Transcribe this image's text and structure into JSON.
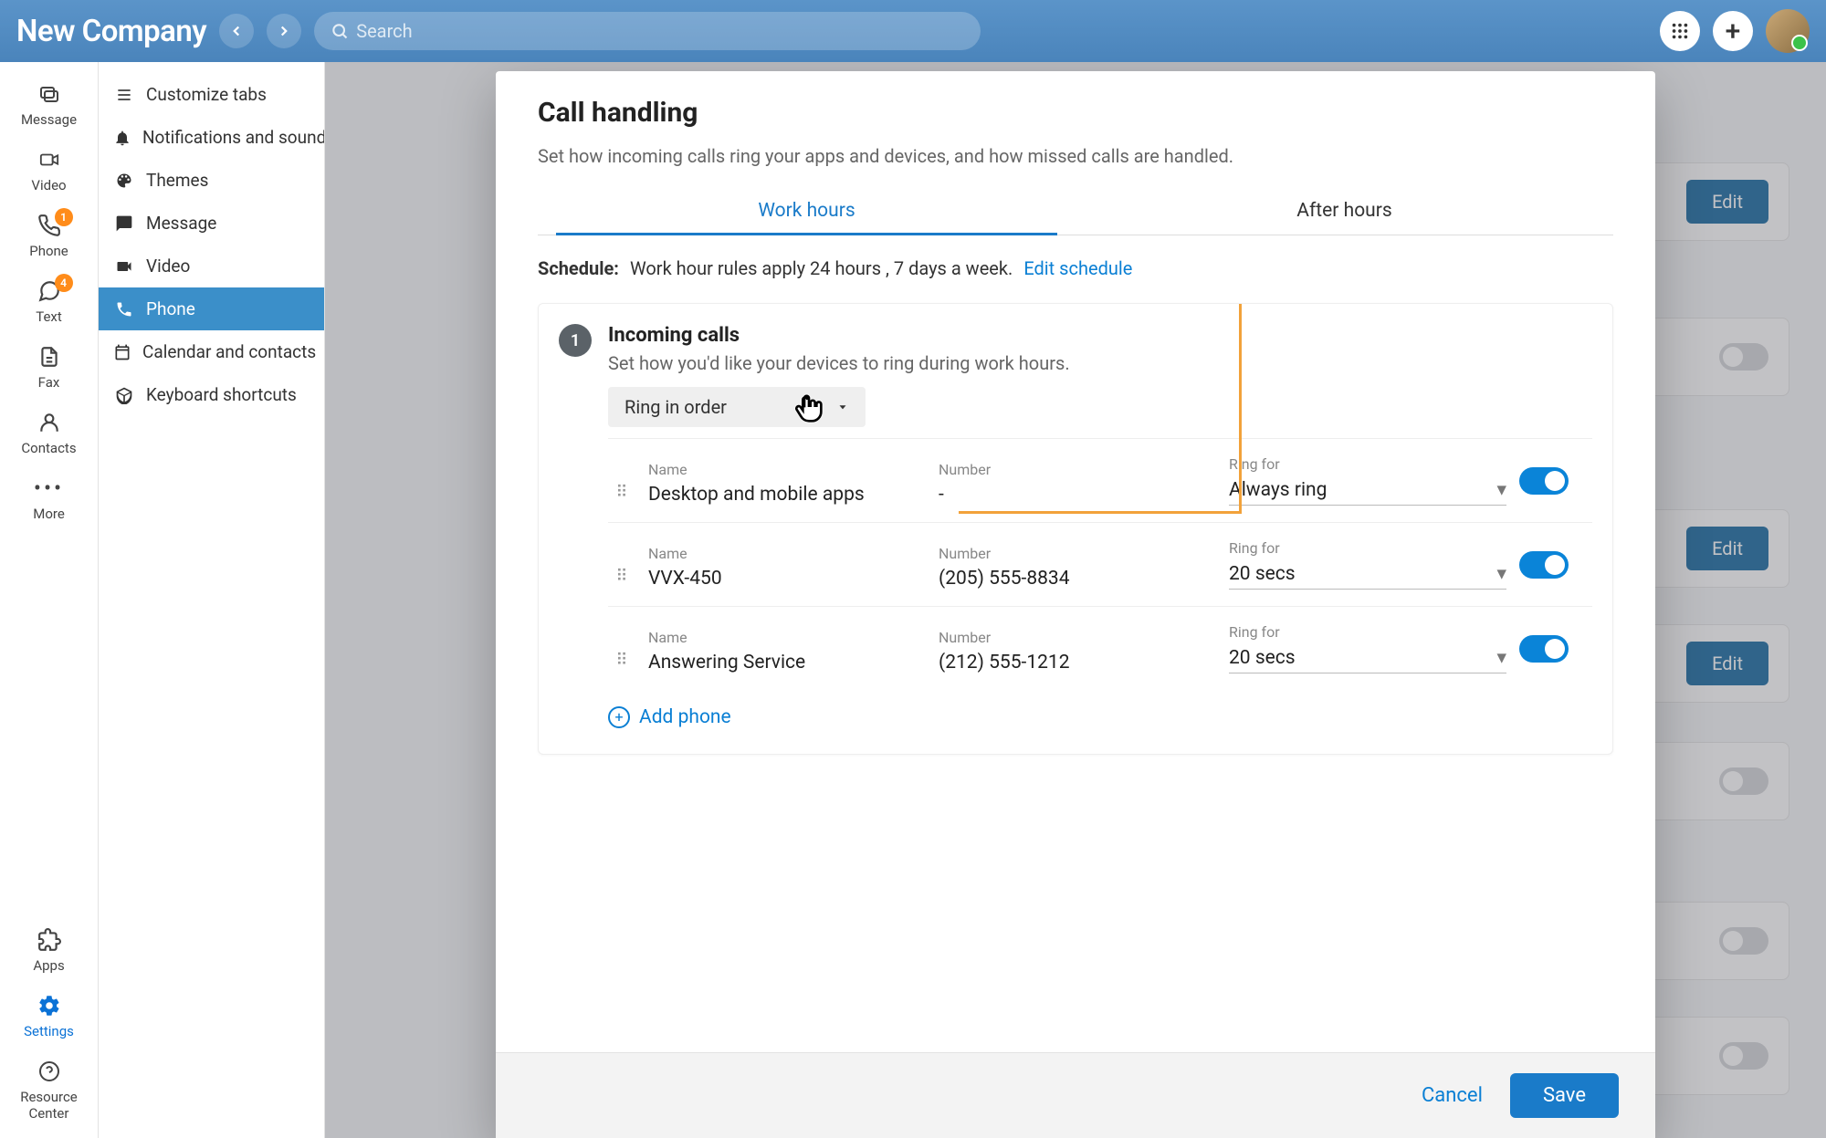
{
  "header": {
    "company": "New Company",
    "search_placeholder": "Search"
  },
  "rail": {
    "message": "Message",
    "video": "Video",
    "phone": "Phone",
    "phone_badge": "1",
    "text": "Text",
    "text_badge": "4",
    "fax": "Fax",
    "contacts": "Contacts",
    "more": "More",
    "apps": "Apps",
    "settings": "Settings",
    "resource_center": "Resource Center"
  },
  "settings_side": {
    "customize": "Customize tabs",
    "notifications": "Notifications and sounds",
    "themes": "Themes",
    "message": "Message",
    "video": "Video",
    "phone": "Phone",
    "calendar": "Calendar and contacts",
    "keyboard": "Keyboard shortcuts"
  },
  "bg": {
    "edit": "Edit"
  },
  "modal": {
    "title": "Call handling",
    "subtitle": "Set how incoming calls ring your apps and devices, and how missed calls are handled.",
    "tabs": {
      "work": "Work hours",
      "after": "After hours"
    },
    "schedule_label": "Schedule:",
    "schedule_text": "Work hour rules apply 24 hours , 7 days a week.",
    "edit_schedule": "Edit schedule",
    "step1_num": "1",
    "step1_title": "Incoming calls",
    "step1_desc": "Set how you'd like your devices to ring during work hours.",
    "ring_mode": "Ring in order",
    "cols": {
      "name": "Name",
      "number": "Number",
      "ring_for": "Ring for"
    },
    "devices": [
      {
        "name": "Desktop and mobile apps",
        "number": "-",
        "ring_for": "Always ring",
        "on": true
      },
      {
        "name": "VVX-450",
        "number": "(205) 555-8834",
        "ring_for": "20 secs",
        "on": true
      },
      {
        "name": "Answering Service",
        "number": "(212) 555-1212",
        "ring_for": "20 secs",
        "on": true
      }
    ],
    "add_phone": "Add phone",
    "cancel": "Cancel",
    "save": "Save"
  }
}
